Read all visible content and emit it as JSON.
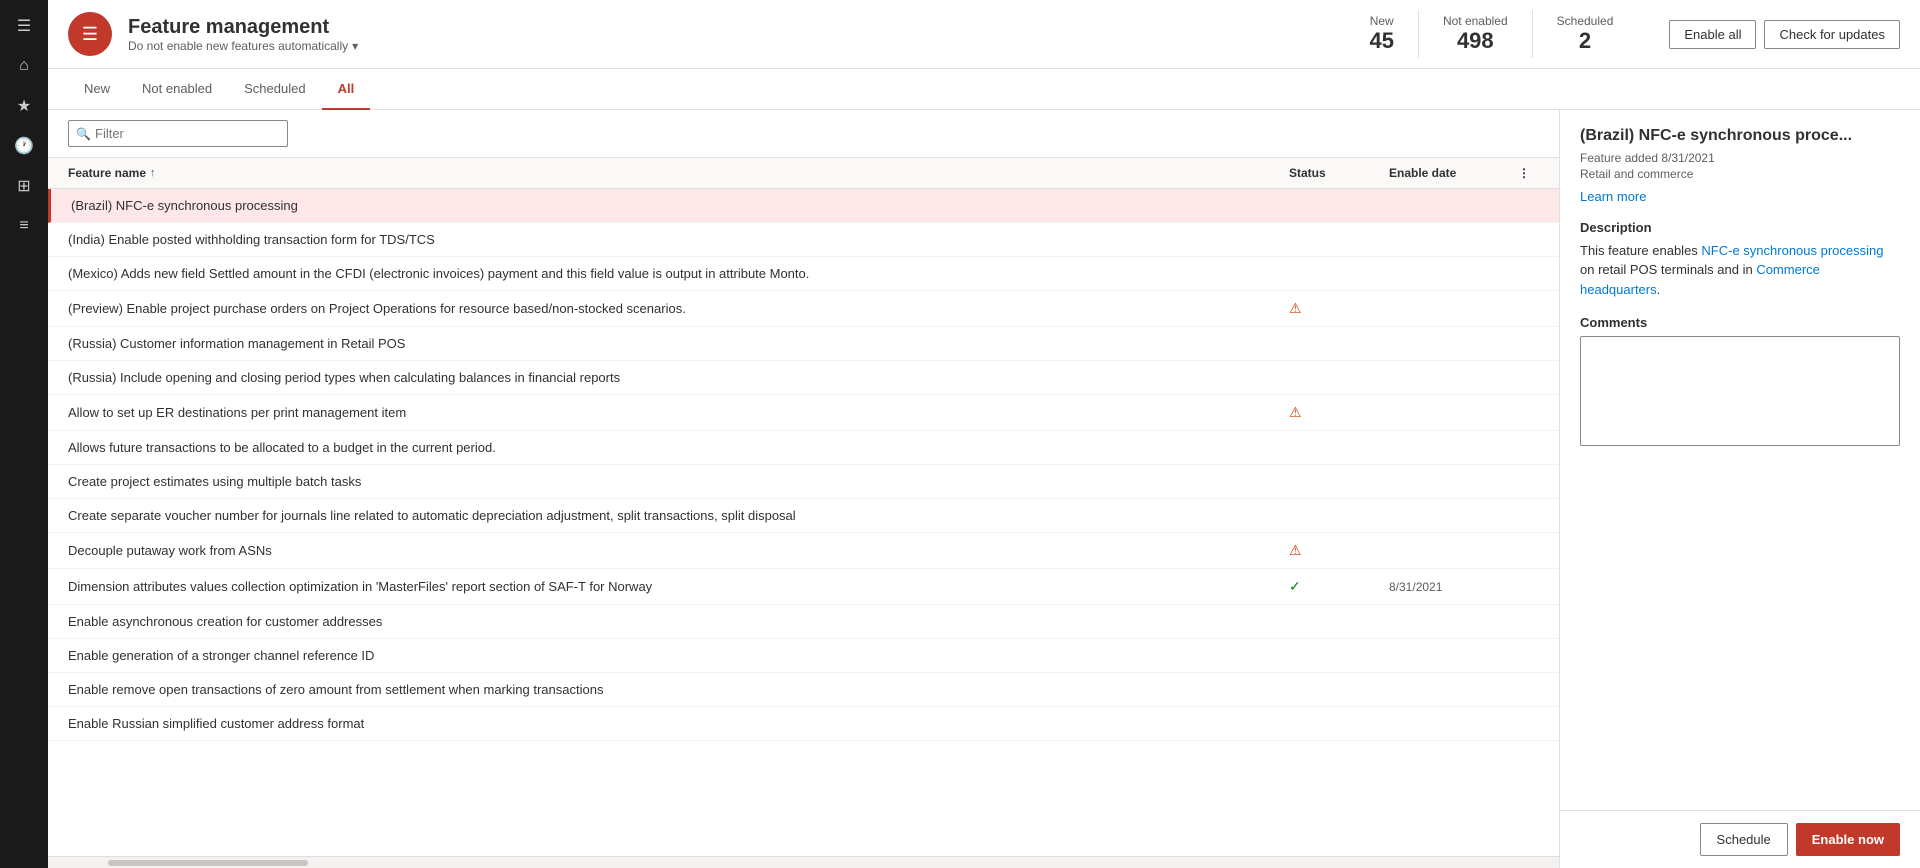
{
  "leftNav": {
    "icons": [
      {
        "name": "hamburger-icon",
        "symbol": "☰"
      },
      {
        "name": "home-icon",
        "symbol": "⌂"
      },
      {
        "name": "favorites-icon",
        "symbol": "★"
      },
      {
        "name": "recent-icon",
        "symbol": "🕐"
      },
      {
        "name": "workspace-icon",
        "symbol": "⊞"
      },
      {
        "name": "list-icon",
        "symbol": "≡"
      }
    ]
  },
  "header": {
    "iconSymbol": "☰",
    "title": "Feature management",
    "subtitle": "Do not enable new features automatically",
    "subtitleChevron": "▾",
    "stats": [
      {
        "label": "New",
        "value": "45"
      },
      {
        "label": "Not enabled",
        "value": "498"
      },
      {
        "label": "Scheduled",
        "value": "2"
      }
    ],
    "enableAllLabel": "Enable all",
    "checkUpdatesLabel": "Check for updates"
  },
  "tabs": [
    {
      "label": "New",
      "active": false
    },
    {
      "label": "Not enabled",
      "active": false
    },
    {
      "label": "Scheduled",
      "active": false
    },
    {
      "label": "All",
      "active": true
    }
  ],
  "filterPlaceholder": "Filter",
  "tableColumns": {
    "name": "Feature name",
    "status": "Status",
    "enableDate": "Enable date"
  },
  "features": [
    {
      "name": "(Brazil) NFC-e synchronous processing",
      "status": "",
      "enableDate": "",
      "warning": false,
      "success": false,
      "selected": true
    },
    {
      "name": "(India) Enable posted withholding transaction form for TDS/TCS",
      "status": "",
      "enableDate": "",
      "warning": false,
      "success": false,
      "selected": false
    },
    {
      "name": "(Mexico) Adds new field Settled amount in the CFDI (electronic invoices) payment and this field value is output in attribute Monto.",
      "status": "",
      "enableDate": "",
      "warning": false,
      "success": false,
      "selected": false
    },
    {
      "name": "(Preview) Enable project purchase orders on Project Operations for resource based/non-stocked scenarios.",
      "status": "warning",
      "enableDate": "",
      "warning": true,
      "success": false,
      "selected": false
    },
    {
      "name": "(Russia) Customer information management in Retail POS",
      "status": "",
      "enableDate": "",
      "warning": false,
      "success": false,
      "selected": false
    },
    {
      "name": "(Russia) Include opening and closing period types when calculating balances in financial reports",
      "status": "",
      "enableDate": "",
      "warning": false,
      "success": false,
      "selected": false
    },
    {
      "name": "Allow to set up ER destinations per print management item",
      "status": "warning",
      "enableDate": "",
      "warning": true,
      "success": false,
      "selected": false
    },
    {
      "name": "Allows future transactions to be allocated to a budget in the current period.",
      "status": "",
      "enableDate": "",
      "warning": false,
      "success": false,
      "selected": false
    },
    {
      "name": "Create project estimates using multiple batch tasks",
      "status": "",
      "enableDate": "",
      "warning": false,
      "success": false,
      "selected": false
    },
    {
      "name": "Create separate voucher number for journals line related to automatic depreciation adjustment, split transactions, split disposal",
      "status": "",
      "enableDate": "",
      "warning": false,
      "success": false,
      "selected": false
    },
    {
      "name": "Decouple putaway work from ASNs",
      "status": "warning",
      "enableDate": "",
      "warning": true,
      "success": false,
      "selected": false
    },
    {
      "name": "Dimension attributes values collection optimization in 'MasterFiles' report section of SAF-T for Norway",
      "status": "success",
      "enableDate": "8/31/2021",
      "warning": false,
      "success": true,
      "selected": false
    },
    {
      "name": "Enable asynchronous creation for customer addresses",
      "status": "",
      "enableDate": "",
      "warning": false,
      "success": false,
      "selected": false
    },
    {
      "name": "Enable generation of a stronger channel reference ID",
      "status": "",
      "enableDate": "",
      "warning": false,
      "success": false,
      "selected": false
    },
    {
      "name": "Enable remove open transactions of zero amount from settlement when marking transactions",
      "status": "",
      "enableDate": "",
      "warning": false,
      "success": false,
      "selected": false
    },
    {
      "name": "Enable Russian simplified customer address format",
      "status": "",
      "enableDate": "",
      "warning": false,
      "success": false,
      "selected": false
    }
  ],
  "detail": {
    "title": "(Brazil) NFC-e synchronous proce...",
    "featureAdded": "Feature added 8/31/2021",
    "module": "Retail and commerce",
    "learnMoreLabel": "Learn more",
    "descriptionTitle": "Description",
    "descriptionText": "This feature enables NFC-e synchronous processing on retail POS terminals and in Commerce headquarters.",
    "descriptionHighlight1": "NFC-e synchronous processing",
    "descriptionHighlight2": "Commerce headquarters",
    "commentsLabel": "Comments",
    "scheduleLabel": "Schedule",
    "enableNowLabel": "Enable now"
  }
}
